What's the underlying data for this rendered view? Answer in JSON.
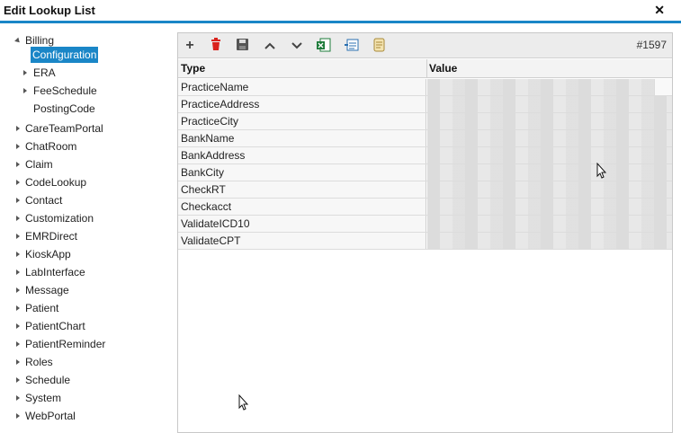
{
  "window": {
    "title": "Edit Lookup List"
  },
  "tree": {
    "billing": {
      "label": "Billing",
      "children": [
        "Configuration",
        "ERA",
        "FeeSchedule",
        "PostingCode"
      ]
    },
    "items": [
      "CareTeamPortal",
      "ChatRoom",
      "Claim",
      "CodeLookup",
      "Contact",
      "Customization",
      "EMRDirect",
      "KioskApp",
      "LabInterface",
      "Message",
      "Patient",
      "PatientChart",
      "PatientReminder",
      "Roles",
      "Schedule",
      "System",
      "WebPortal"
    ]
  },
  "toolbar": {
    "record_id": "#1597",
    "icons": [
      "add-icon",
      "delete-icon",
      "save-icon",
      "move-up-icon",
      "move-down-icon",
      "export-excel-icon",
      "import-icon",
      "script-icon"
    ]
  },
  "grid": {
    "columns": [
      "Type",
      "Value"
    ],
    "rows": [
      {
        "type": "PracticeName",
        "value_fill": 0.93
      },
      {
        "type": "PracticeAddress",
        "value_fill": 1.0
      },
      {
        "type": "PracticeCity",
        "value_fill": 1.0
      },
      {
        "type": "BankName",
        "value_fill": 1.0
      },
      {
        "type": "BankAddress",
        "value_fill": 1.0
      },
      {
        "type": "BankCity",
        "value_fill": 1.0
      },
      {
        "type": "CheckRT",
        "value_fill": 1.0
      },
      {
        "type": "Checkacct",
        "value_fill": 1.0
      },
      {
        "type": "ValidateICD10",
        "value_fill": 1.0
      },
      {
        "type": "ValidateCPT",
        "value_fill": 1.0
      }
    ]
  },
  "colors": {
    "accent": "#1a86c7",
    "delete": "#d9221c",
    "excel": "#1d7b3a"
  }
}
